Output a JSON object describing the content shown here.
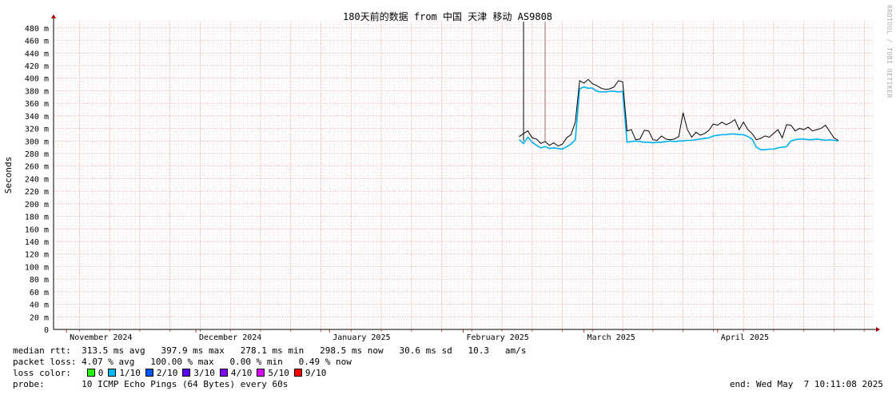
{
  "chart_data": {
    "type": "line",
    "title": "180天前的数据 from 中国 天津 移动 AS9808",
    "ylabel": "Seconds",
    "xlabel": "",
    "ylim": [
      0,
      490
    ],
    "y_unit": "ms",
    "y_ticks": [
      {
        "value": 0,
        "label": "0"
      },
      {
        "value": 20,
        "label": "20 m"
      },
      {
        "value": 40,
        "label": "40 m"
      },
      {
        "value": 60,
        "label": "60 m"
      },
      {
        "value": 80,
        "label": "80 m"
      },
      {
        "value": 100,
        "label": "100 m"
      },
      {
        "value": 120,
        "label": "120 m"
      },
      {
        "value": 140,
        "label": "140 m"
      },
      {
        "value": 160,
        "label": "160 m"
      },
      {
        "value": 180,
        "label": "180 m"
      },
      {
        "value": 200,
        "label": "200 m"
      },
      {
        "value": 220,
        "label": "220 m"
      },
      {
        "value": 240,
        "label": "240 m"
      },
      {
        "value": 260,
        "label": "260 m"
      },
      {
        "value": 280,
        "label": "280 m"
      },
      {
        "value": 300,
        "label": "300 m"
      },
      {
        "value": 320,
        "label": "320 m"
      },
      {
        "value": 340,
        "label": "340 m"
      },
      {
        "value": 360,
        "label": "360 m"
      },
      {
        "value": 380,
        "label": "380 m"
      },
      {
        "value": 400,
        "label": "400 m"
      },
      {
        "value": 420,
        "label": "420 m"
      },
      {
        "value": 440,
        "label": "440 m"
      },
      {
        "value": 460,
        "label": "460 m"
      },
      {
        "value": 480,
        "label": "480 m"
      }
    ],
    "x_range": [
      "2024-10-29",
      "2025-05-07"
    ],
    "x_ticks": [
      {
        "date": "2024-11-01",
        "label": "November 2024"
      },
      {
        "date": "2024-12-01",
        "label": "December 2024"
      },
      {
        "date": "2025-01-01",
        "label": "January 2025"
      },
      {
        "date": "2025-02-01",
        "label": "February 2025"
      },
      {
        "date": "2025-03-01",
        "label": "March 2025"
      },
      {
        "date": "2025-04-01",
        "label": "April 2025"
      }
    ],
    "grid": true,
    "series": [
      {
        "color": "#00b0f0",
        "points": [
          [
            "2025-02-14",
            302
          ],
          [
            "2025-02-15",
            296
          ],
          [
            "2025-02-16",
            306
          ],
          [
            "2025-02-17",
            298
          ],
          [
            "2025-02-18",
            293
          ],
          [
            "2025-02-19",
            289
          ],
          [
            "2025-02-20",
            291
          ],
          [
            "2025-02-21",
            288
          ],
          [
            "2025-02-22",
            289
          ],
          [
            "2025-02-23",
            288
          ],
          [
            "2025-02-24",
            287
          ],
          [
            "2025-02-25",
            291
          ],
          [
            "2025-02-26",
            295
          ],
          [
            "2025-02-27",
            302
          ],
          [
            "2025-02-28",
            383
          ],
          [
            "2025-03-01",
            386
          ],
          [
            "2025-03-02",
            384
          ],
          [
            "2025-03-03",
            384
          ],
          [
            "2025-03-04",
            379
          ],
          [
            "2025-03-05",
            378
          ],
          [
            "2025-03-06",
            378
          ],
          [
            "2025-03-07",
            379
          ],
          [
            "2025-03-08",
            379
          ],
          [
            "2025-03-09",
            378
          ],
          [
            "2025-03-10",
            379
          ],
          [
            "2025-03-11",
            298
          ],
          [
            "2025-03-12",
            299
          ],
          [
            "2025-03-13",
            300
          ],
          [
            "2025-03-14",
            299
          ],
          [
            "2025-03-15",
            298
          ],
          [
            "2025-03-16",
            298
          ],
          [
            "2025-03-17",
            297
          ],
          [
            "2025-03-18",
            298
          ],
          [
            "2025-03-19",
            298
          ],
          [
            "2025-03-20",
            299
          ],
          [
            "2025-03-21",
            300
          ],
          [
            "2025-03-22",
            299
          ],
          [
            "2025-03-23",
            300
          ],
          [
            "2025-03-24",
            300
          ],
          [
            "2025-03-25",
            301
          ],
          [
            "2025-03-26",
            301
          ],
          [
            "2025-03-27",
            302
          ],
          [
            "2025-03-28",
            303
          ],
          [
            "2025-03-29",
            304
          ],
          [
            "2025-03-30",
            305
          ],
          [
            "2025-03-31",
            308
          ],
          [
            "2025-04-01",
            309
          ],
          [
            "2025-04-02",
            310
          ],
          [
            "2025-04-03",
            310
          ],
          [
            "2025-04-04",
            311
          ],
          [
            "2025-04-05",
            311
          ],
          [
            "2025-04-06",
            310
          ],
          [
            "2025-04-07",
            310
          ],
          [
            "2025-04-08",
            307
          ],
          [
            "2025-04-09",
            303
          ],
          [
            "2025-04-10",
            290
          ],
          [
            "2025-04-11",
            286
          ],
          [
            "2025-04-12",
            286
          ],
          [
            "2025-04-13",
            287
          ],
          [
            "2025-04-14",
            287
          ],
          [
            "2025-04-15",
            289
          ],
          [
            "2025-04-16",
            290
          ],
          [
            "2025-04-17",
            291
          ],
          [
            "2025-04-18",
            300
          ],
          [
            "2025-04-19",
            302
          ],
          [
            "2025-04-20",
            303
          ],
          [
            "2025-04-21",
            303
          ],
          [
            "2025-04-22",
            302
          ],
          [
            "2025-04-23",
            302
          ],
          [
            "2025-04-24",
            303
          ],
          [
            "2025-04-25",
            302
          ],
          [
            "2025-04-26",
            301
          ],
          [
            "2025-04-27",
            302
          ],
          [
            "2025-04-28",
            301
          ],
          [
            "2025-04-29",
            300
          ]
        ]
      },
      {
        "color": "#000000",
        "points": [
          [
            "2025-02-14",
            307
          ],
          [
            "2025-02-15",
            312
          ],
          [
            "2025-02-16",
            316
          ],
          [
            "2025-02-17",
            305
          ],
          [
            "2025-02-18",
            303
          ],
          [
            "2025-02-19",
            296
          ],
          [
            "2025-02-20",
            299
          ],
          [
            "2025-02-21",
            293
          ],
          [
            "2025-02-22",
            297
          ],
          [
            "2025-02-23",
            292
          ],
          [
            "2025-02-24",
            295
          ],
          [
            "2025-02-25",
            305
          ],
          [
            "2025-02-26",
            310
          ],
          [
            "2025-02-27",
            330
          ],
          [
            "2025-02-28",
            396
          ],
          [
            "2025-03-01",
            392
          ],
          [
            "2025-03-02",
            398
          ],
          [
            "2025-03-03",
            391
          ],
          [
            "2025-03-04",
            388
          ],
          [
            "2025-03-05",
            384
          ],
          [
            "2025-03-06",
            382
          ],
          [
            "2025-03-07",
            383
          ],
          [
            "2025-03-08",
            386
          ],
          [
            "2025-03-09",
            396
          ],
          [
            "2025-03-10",
            394
          ],
          [
            "2025-03-11",
            316
          ],
          [
            "2025-03-12",
            318
          ],
          [
            "2025-03-13",
            302
          ],
          [
            "2025-03-14",
            303
          ],
          [
            "2025-03-15",
            317
          ],
          [
            "2025-03-16",
            316
          ],
          [
            "2025-03-17",
            302
          ],
          [
            "2025-03-18",
            301
          ],
          [
            "2025-03-19",
            308
          ],
          [
            "2025-03-20",
            303
          ],
          [
            "2025-03-21",
            302
          ],
          [
            "2025-03-22",
            303
          ],
          [
            "2025-03-23",
            307
          ],
          [
            "2025-03-24",
            345
          ],
          [
            "2025-03-25",
            318
          ],
          [
            "2025-03-26",
            306
          ],
          [
            "2025-03-27",
            314
          ],
          [
            "2025-03-28",
            309
          ],
          [
            "2025-03-29",
            312
          ],
          [
            "2025-03-30",
            317
          ],
          [
            "2025-03-31",
            327
          ],
          [
            "2025-04-01",
            325
          ],
          [
            "2025-04-02",
            330
          ],
          [
            "2025-04-03",
            326
          ],
          [
            "2025-04-04",
            329
          ],
          [
            "2025-04-05",
            334
          ],
          [
            "2025-04-06",
            318
          ],
          [
            "2025-04-07",
            330
          ],
          [
            "2025-04-08",
            318
          ],
          [
            "2025-04-09",
            312
          ],
          [
            "2025-04-10",
            302
          ],
          [
            "2025-04-11",
            304
          ],
          [
            "2025-04-12",
            308
          ],
          [
            "2025-04-13",
            306
          ],
          [
            "2025-04-14",
            312
          ],
          [
            "2025-04-15",
            318
          ],
          [
            "2025-04-16",
            305
          ],
          [
            "2025-04-17",
            326
          ],
          [
            "2025-04-18",
            325
          ],
          [
            "2025-04-19",
            316
          ],
          [
            "2025-04-20",
            320
          ],
          [
            "2025-04-21",
            318
          ],
          [
            "2025-04-22",
            322
          ],
          [
            "2025-04-23",
            316
          ],
          [
            "2025-04-24",
            318
          ],
          [
            "2025-04-25",
            320
          ],
          [
            "2025-04-26",
            325
          ],
          [
            "2025-04-27",
            315
          ],
          [
            "2025-04-28",
            305
          ],
          [
            "2025-04-29",
            301
          ]
        ]
      }
    ],
    "spikes": [
      {
        "date": "2025-02-15",
        "value": 490,
        "color": "#000000"
      },
      {
        "date": "2025-02-20",
        "value": 490,
        "color": "#996666"
      }
    ]
  },
  "legend": {
    "median_label": "median rtt:",
    "median_stats": "313.5 ms avg   397.9 ms max   278.1 ms min   298.5 ms now   30.6 ms sd   10.3   am/s",
    "loss_label": "packet loss:",
    "loss_stats": "4.07 % avg   100.00 % max   0.00 % min   0.49 % now",
    "color_label": "loss color:",
    "loss_colors": [
      {
        "label": "0",
        "color": "#26ff00"
      },
      {
        "label": "1/10",
        "color": "#00b8ff"
      },
      {
        "label": "2/10",
        "color": "#0059ff"
      },
      {
        "label": "3/10",
        "color": "#5e00ff"
      },
      {
        "label": "4/10",
        "color": "#7e00ff"
      },
      {
        "label": "5/10",
        "color": "#dd00ff"
      },
      {
        "label": "9/10",
        "color": "#ff0000"
      }
    ],
    "probe_label": "probe:",
    "probe_text": "10 ICMP Echo Pings (64 Bytes) every 60s",
    "end_text": "end: Wed May  7 10:11:08 2025"
  },
  "watermark": "RRDTOOL / TOBI OETIKER"
}
